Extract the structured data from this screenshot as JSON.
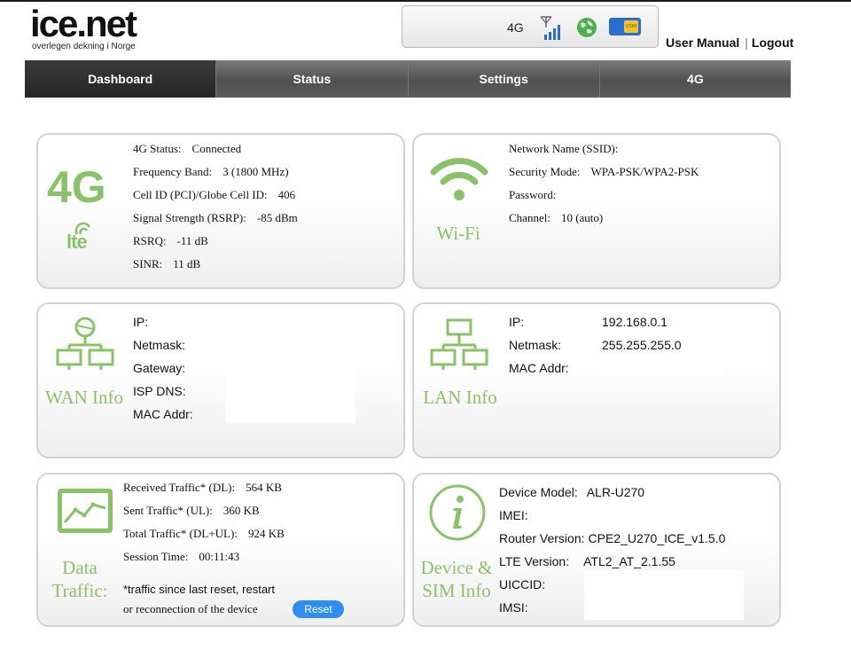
{
  "logo": {
    "name": "ice.net",
    "tagline": "overlegen dekning i Norge"
  },
  "status_bar": {
    "network_type": "4G",
    "icons": [
      "signal-bars-icon",
      "globe-icon",
      "usim-card-icon"
    ],
    "sim_label": "USIM"
  },
  "header_links": {
    "user_manual": "User Manual",
    "separator": "|",
    "logout": "Logout"
  },
  "nav": {
    "tabs": [
      {
        "label": "Dashboard",
        "active": true
      },
      {
        "label": "Status",
        "active": false
      },
      {
        "label": "Settings",
        "active": false
      },
      {
        "label": "4G",
        "active": false
      }
    ]
  },
  "cards": {
    "lte": {
      "big_label": "4G",
      "lte_logo_text": "lte",
      "rows": [
        {
          "label": "4G Status:",
          "value": "Connected"
        },
        {
          "label": "Frequency Band:",
          "value": "3 (1800 MHz)"
        },
        {
          "label": "Cell ID (PCI)/Globe Cell ID:",
          "value": "406"
        },
        {
          "label": "Signal Strength (RSRP):",
          "value": "-85 dBm"
        },
        {
          "label": "RSRQ:",
          "value": "-11 dB"
        },
        {
          "label": "SINR:",
          "value": "11 dB"
        }
      ]
    },
    "wifi": {
      "title": "Wi-Fi",
      "rows": [
        {
          "label": "Network Name (SSID):",
          "value": ""
        },
        {
          "label": "Security Mode:",
          "value": "WPA-PSK/WPA2-PSK"
        },
        {
          "label": "Password:",
          "value": ""
        },
        {
          "label": "Channel:",
          "value": "10 (auto)"
        }
      ]
    },
    "wan": {
      "title": "WAN Info",
      "rows": [
        {
          "label": "IP:",
          "value": ""
        },
        {
          "label": "Netmask:",
          "value": ""
        },
        {
          "label": "Gateway:",
          "value": ""
        },
        {
          "label": "ISP DNS:",
          "value": ""
        },
        {
          "label": "MAC Addr:",
          "value": ""
        }
      ]
    },
    "lan": {
      "title": "LAN Info",
      "rows": [
        {
          "label": "IP:",
          "value": "192.168.0.1"
        },
        {
          "label": "Netmask:",
          "value": "255.255.255.0"
        },
        {
          "label": "MAC Addr:",
          "value": ""
        }
      ]
    },
    "traffic": {
      "title_line1": "Data",
      "title_line2": "Traffic:",
      "rows": [
        {
          "label": "Received Traffic* (DL):",
          "value": "564 KB"
        },
        {
          "label": "Sent Traffic* (UL):",
          "value": "360 KB"
        },
        {
          "label": "Total Traffic* (DL+UL):",
          "value": "924 KB"
        },
        {
          "label": "Session Time:",
          "value": "00:11:43"
        }
      ],
      "note_line1": "*traffic since last reset, restart",
      "note_line2": "or reconnection of the device",
      "reset_label": "Reset"
    },
    "device": {
      "title_line1": "Device &",
      "title_line2": "SIM Info",
      "rows": [
        {
          "label": "Device Model:",
          "value": "ALR-U270"
        },
        {
          "label": "IMEI:",
          "value": ""
        },
        {
          "label": "Router Version:",
          "value": "CPE2_U270_ICE_v1.5.0"
        },
        {
          "label": "LTE Version:",
          "value": "ATL2_AT_2.1.55"
        },
        {
          "label": "UICCID:",
          "value": ""
        },
        {
          "label": "IMSI:",
          "value": ""
        }
      ]
    }
  },
  "colors": {
    "accent_green": "#8ac26a",
    "nav_dark": "#555555",
    "reset_blue": "#2d8ef0"
  }
}
